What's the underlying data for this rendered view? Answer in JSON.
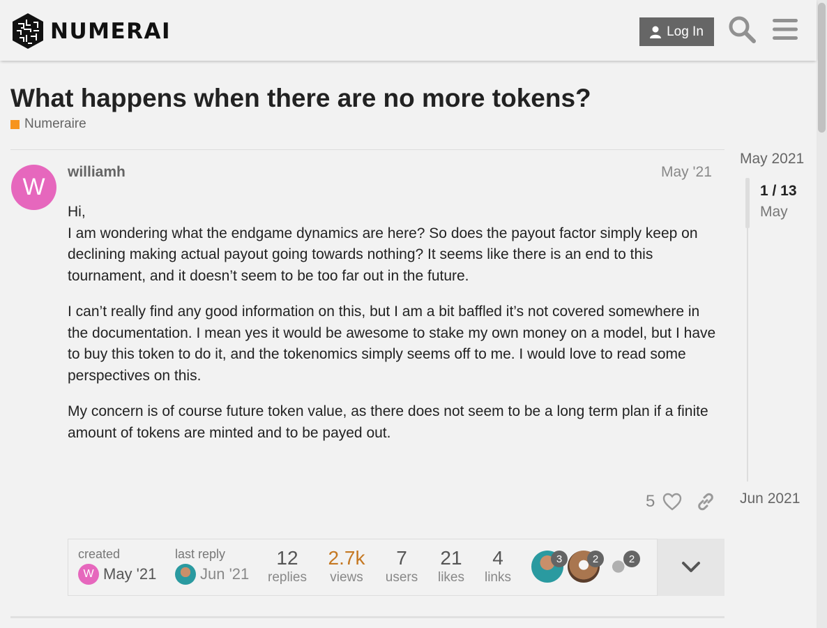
{
  "header": {
    "logo_text": "NUMERAI",
    "login_label": "Log In"
  },
  "topic": {
    "title": "What happens when there are no more tokens?",
    "category": "Numeraire",
    "category_color": "#f7941d"
  },
  "post": {
    "avatar_letter": "W",
    "avatar_color": "#e667bd",
    "username": "williamh",
    "date": "May '21",
    "paragraphs": [
      "Hi,\nI am wondering what the endgame dynamics are here? So does the payout factor simply keep on declining making actual payout going towards nothing? It seems like there is an end to this tournament, and it doesn’t seem to be too far out in the future.",
      "I can’t really find any good information on this, but I am a bit baffled it’s not covered somewhere in the documentation. I mean yes it would be awesome to stake my own money on a model, but I have to buy this token to do it, and the tokenomics simply seems off to me. I would love to read some perspectives on this.",
      "My concern is of course future token value, as there does not seem to be a long term plan if a finite amount of tokens are minted and to be payed out."
    ],
    "like_count": "5"
  },
  "topic_map": {
    "created_label": "created",
    "created_date": "May '21",
    "created_avatar_letter": "W",
    "last_reply_label": "last reply",
    "last_reply_date": "Jun '21",
    "replies": "12",
    "replies_label": "replies",
    "views": "2.7k",
    "views_label": "views",
    "users": "7",
    "users_label": "users",
    "likes": "21",
    "likes_label": "likes",
    "links": "4",
    "links_label": "links",
    "participants": [
      {
        "count": "3"
      },
      {
        "count": "2"
      },
      {
        "count": "2"
      }
    ]
  },
  "timeline": {
    "start": "May 2021",
    "position": "1 / 13",
    "month": "May",
    "end": "Jun 2021"
  }
}
